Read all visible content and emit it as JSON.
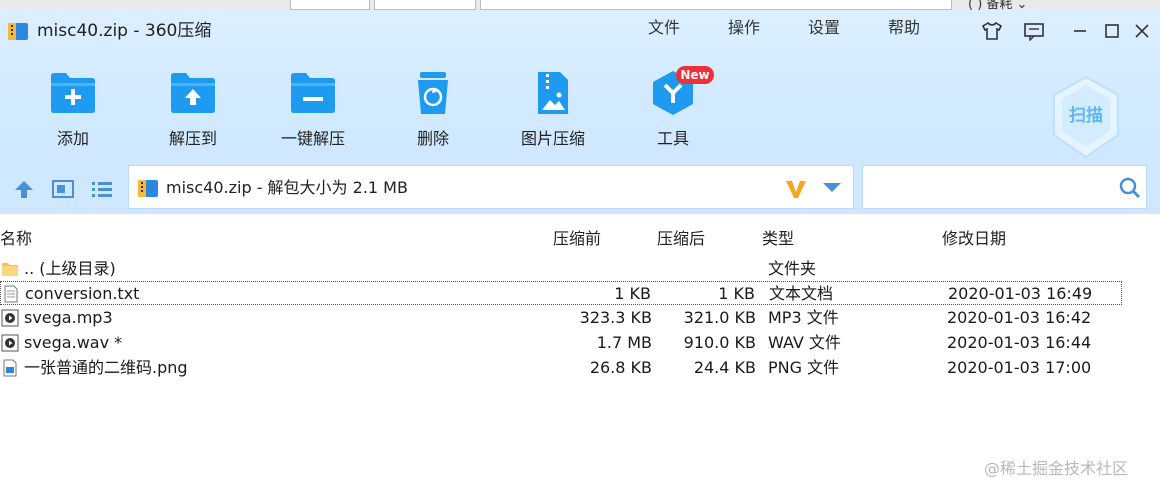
{
  "window": {
    "title": "misc40.zip - 360压缩"
  },
  "background_window": {
    "fragment": "( ) 备耗 ⌄"
  },
  "menu": {
    "file": "文件",
    "ops": "操作",
    "settings": "设置",
    "help": "帮助"
  },
  "toolbar": {
    "add": "添加",
    "extract_to": "解压到",
    "one_click_extract": "一键解压",
    "delete": "删除",
    "image_compress": "图片压缩",
    "tools": "工具",
    "tools_badge": "New",
    "scan": "扫描"
  },
  "address": {
    "path": "misc40.zip - 解包大小为 2.1 MB",
    "search_value": ""
  },
  "columns": {
    "name": "名称",
    "size": "压缩前",
    "packed": "压缩后",
    "type": "类型",
    "modified": "修改日期"
  },
  "files": [
    {
      "icon": "folder-up-icon",
      "name": ".. (上级目录)",
      "size": "",
      "packed": "",
      "type": "文件夹",
      "date": ""
    },
    {
      "icon": "text-file-icon",
      "name": "conversion.txt",
      "size": "1 KB",
      "packed": "1 KB",
      "type": "文本文档",
      "date": "2020-01-03 16:49"
    },
    {
      "icon": "audio-file-icon",
      "name": "svega.mp3",
      "size": "323.3 KB",
      "packed": "321.0 KB",
      "type": "MP3 文件",
      "date": "2020-01-03 16:42"
    },
    {
      "icon": "audio-file-icon",
      "name": "svega.wav *",
      "size": "1.7 MB",
      "packed": "910.0 KB",
      "type": "WAV 文件",
      "date": "2020-01-03 16:44"
    },
    {
      "icon": "image-file-icon",
      "name": "一张普通的二维码.png",
      "size": "26.8 KB",
      "packed": "24.4 KB",
      "type": "PNG 文件",
      "date": "2020-01-03 17:00"
    }
  ],
  "selected_row": 1,
  "watermark": "@稀土掘金技术社区",
  "colors": {
    "accent": "#1e9bf0",
    "header_bg": "#d2eaff",
    "badge": "#ef2f3a"
  }
}
